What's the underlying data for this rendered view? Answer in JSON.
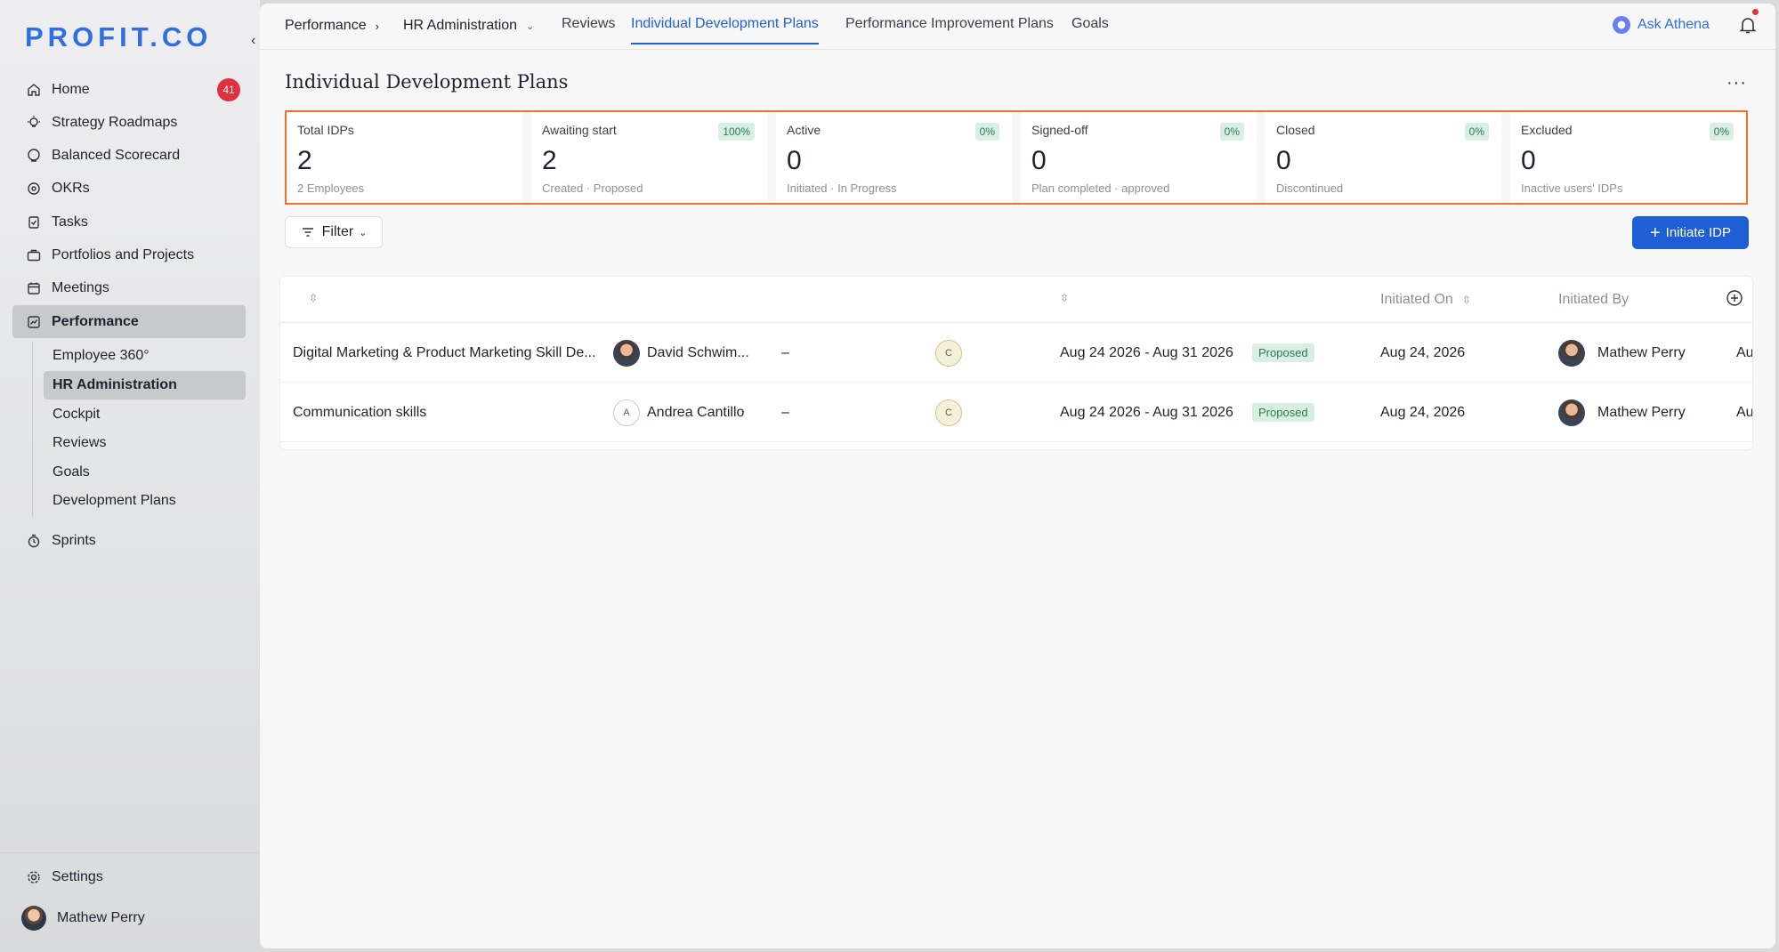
{
  "app": {
    "logo": "PROFIT.CO"
  },
  "sidebar": {
    "home_badge": "41",
    "items": [
      {
        "label": "Home",
        "icon": "home-icon"
      },
      {
        "label": "Strategy Roadmaps",
        "icon": "bulb-icon"
      },
      {
        "label": "Balanced Scorecard",
        "icon": "scorecard-icon"
      },
      {
        "label": "OKRs",
        "icon": "target-icon"
      },
      {
        "label": "Tasks",
        "icon": "clipboard-icon"
      },
      {
        "label": "Portfolios and Projects",
        "icon": "briefcase-icon"
      },
      {
        "label": "Meetings",
        "icon": "calendar-icon"
      },
      {
        "label": "Performance",
        "icon": "chart-icon"
      }
    ],
    "sub_items": [
      {
        "label": "Employee 360°"
      },
      {
        "label": "HR Administration"
      },
      {
        "label": "Cockpit"
      },
      {
        "label": "Reviews"
      },
      {
        "label": "Goals"
      },
      {
        "label": "Development Plans"
      }
    ],
    "sprints": "Sprints",
    "settings": "Settings",
    "user": "Mathew Perry"
  },
  "topbar": {
    "crumb1": "Performance",
    "crumb2": "HR Administration",
    "tabs": [
      {
        "label": "Reviews"
      },
      {
        "label": "Individual Development Plans"
      },
      {
        "label": "Performance Improvement Plans"
      },
      {
        "label": "Goals"
      }
    ],
    "ask": "Ask Athena"
  },
  "page": {
    "title": "Individual Development Plans",
    "filter": "Filter",
    "initiate": "Initiate IDP"
  },
  "stats": [
    {
      "label": "Total IDPs",
      "value": "2",
      "sub": "2 Employees",
      "pct": ""
    },
    {
      "label": "Awaiting start",
      "value": "2",
      "sub": "Created · Proposed",
      "pct": "100%"
    },
    {
      "label": "Active",
      "value": "0",
      "sub": "Initiated · In Progress",
      "pct": "0%"
    },
    {
      "label": "Signed-off",
      "value": "0",
      "sub": "Plan completed · approved",
      "pct": "0%"
    },
    {
      "label": "Closed",
      "value": "0",
      "sub": "Discontinued",
      "pct": "0%"
    },
    {
      "label": "Excluded",
      "value": "0",
      "sub": "Inactive users' IDPs",
      "pct": "0%"
    }
  ],
  "table": {
    "headers": {
      "initiated_on": "Initiated On",
      "initiated_by": "Initiated By"
    },
    "rows": [
      {
        "name": "Digital Marketing & Product Marketing Skill De...",
        "employee": "David Schwim...",
        "avatar_letter": "",
        "dash": "–",
        "cycle": "C",
        "period": "Aug 24 2026 - Aug 31 2026",
        "status": "Proposed",
        "initiated_on": "Aug 24, 2026",
        "initiated_by": "Mathew Perry",
        "extra": "Au"
      },
      {
        "name": "Communication skills",
        "employee": "Andrea Cantillo",
        "avatar_letter": "A",
        "dash": "–",
        "cycle": "C",
        "period": "Aug 24 2026 - Aug 31 2026",
        "status": "Proposed",
        "initiated_on": "Aug 24, 2026",
        "initiated_by": "Mathew Perry",
        "extra": "Au"
      }
    ]
  },
  "colors": {
    "accent": "#1f5fd6",
    "highlight_border": "#f0712b",
    "badge_red": "#e0323c",
    "status_green_bg": "#d9efe3"
  }
}
